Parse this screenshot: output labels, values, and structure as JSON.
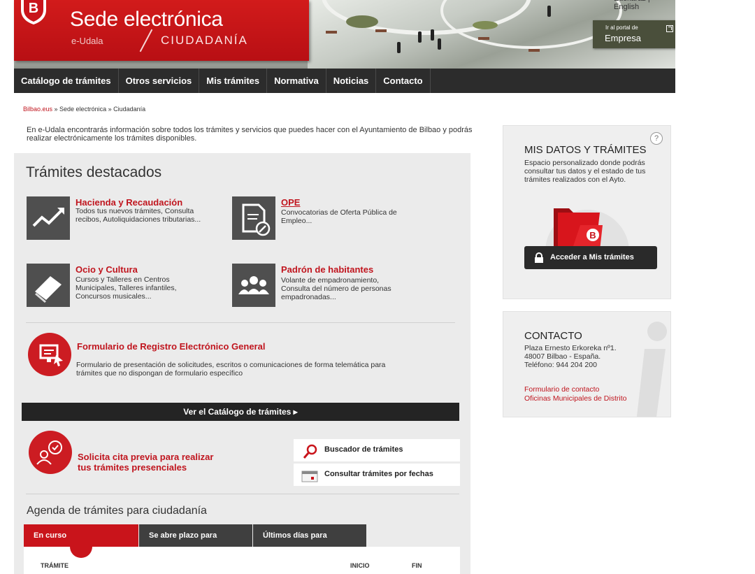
{
  "header": {
    "brand_title": "Sede electrónica",
    "brand_sub": "e-Udala",
    "brand_section": "CIUDADANÍA",
    "brand_logo_letter": "B",
    "languages": "Euskaraz | English",
    "empresa_small": "Ir al portal de",
    "empresa_big": "Empresa"
  },
  "nav": [
    "Catálogo de trámites",
    "Otros servicios",
    "Mis trámites",
    "Normativa",
    "Noticias",
    "Contacto"
  ],
  "breadcrumb": {
    "home": "Bilbao.eus",
    "rest": " » Sede electrónica » Ciudadanía"
  },
  "intro": "En e-Udala encontrarás información sobre todos los trámites y servicios que puedes hacer con el Ayuntamiento de Bilbao y podrás realizar electrónicamente los trámites disponibles.",
  "featured": {
    "title": "Trámites destacados",
    "items": [
      {
        "title": "Hacienda y Recaudación",
        "desc": "Todos tus nuevos trámites, Consulta recibos, Autoliquidaciones tributarias..."
      },
      {
        "title": "OPE",
        "desc": "Convocatorias de Oferta Pública de Empleo..."
      },
      {
        "title": "Ocio y Cultura",
        "desc": "Cursos y Talleres en Centros Municipales, Talleres infantiles, Concursos musicales..."
      },
      {
        "title": "Padrón de habitantes",
        "desc": "Volante de empadronamiento, Consulta del número de personas empadronadas..."
      }
    ],
    "form_title": "Formulario de Registro Electrónico General",
    "form_desc": "Formulario de presentación de solicitudes, escritos o comunicaciones de forma telemática para trámites que no dispongan de formulario específico",
    "catalog_button": "Ver el Catálogo de trámites ▸"
  },
  "appointment": {
    "line1": "Solicita cita previa para realizar",
    "line2": "tus trámites presenciales"
  },
  "quick_links": {
    "search": "Buscador de trámites",
    "dates": "Consultar trámites por fechas"
  },
  "agenda": {
    "title": "Agenda de trámites para ciudadanía",
    "tabs": [
      "En curso",
      "Se abre plazo para",
      "Últimos días para"
    ],
    "columns": [
      "TRÁMITE",
      "INICIO",
      "FIN"
    ]
  },
  "sidebar": {
    "mis_datos": {
      "title": "MIS DATOS Y TRÁMITES",
      "desc": "Espacio personalizado donde podrás consultar tus datos y el estado de tus trámites realizados con el Ayto.",
      "help": "?",
      "button": "Acceder a Mis trámites"
    },
    "contacto": {
      "title": "CONTACTO",
      "address1": "Plaza Ernesto Erkoreka nº1.",
      "address2": "48007 Bilbao - España.",
      "phone": "Teléfono: 944 204 200",
      "link1": "Formulario de contacto",
      "link2": "Oficinas Municipales de Distrito"
    }
  },
  "colors": {
    "brand_red": "#c9141b",
    "nav_bg": "#2c2c2c",
    "panel_bg": "#ebebeb",
    "empresa_bg": "#4a4f3b"
  }
}
